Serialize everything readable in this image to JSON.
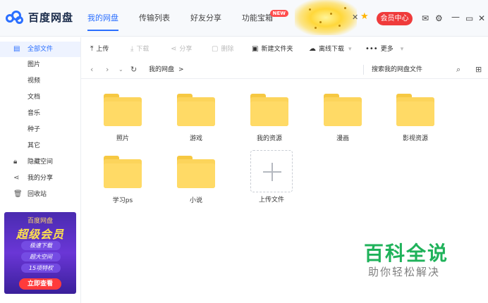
{
  "app": {
    "brand": "百度网盘"
  },
  "nav": {
    "items": [
      {
        "label": "我的网盘",
        "active": true
      },
      {
        "label": "传输列表",
        "active": false
      },
      {
        "label": "好友分享",
        "active": false
      },
      {
        "label": "功能宝箱",
        "active": false,
        "badge": "NEW"
      }
    ]
  },
  "header": {
    "close": "✕",
    "vip_label": "会员中心",
    "icons": [
      "mail-icon",
      "settings-icon",
      "minimize-icon",
      "maximize-icon",
      "close-icon"
    ]
  },
  "sidebar": {
    "items": [
      {
        "label": "全部文件",
        "icon": "file-icon",
        "active": true
      },
      {
        "label": "图片"
      },
      {
        "label": "视频"
      },
      {
        "label": "文档"
      },
      {
        "label": "音乐"
      },
      {
        "label": "种子"
      },
      {
        "label": "其它"
      },
      {
        "label": "隐藏空间",
        "icon": "lock-icon"
      },
      {
        "label": "我的分享",
        "icon": "share-icon"
      },
      {
        "label": "回收站",
        "icon": "trash-icon"
      }
    ]
  },
  "banner": {
    "brand": "百度网盘",
    "title": "超级会员",
    "lines": [
      "极速下载",
      "超大空间",
      "15项特权"
    ],
    "button": "立即查看"
  },
  "toolbar": {
    "upload": "上传",
    "download": "下载",
    "share": "分享",
    "delete": "删除",
    "new_folder": "新建文件夹",
    "offline_download": "离线下载",
    "more": "更多"
  },
  "address": {
    "crumb": "我的网盘",
    "sep": ">",
    "search_placeholder": "搜索我的网盘文件"
  },
  "files": [
    {
      "name": "照片"
    },
    {
      "name": "游戏"
    },
    {
      "name": "我的资源"
    },
    {
      "name": "漫画"
    },
    {
      "name": "影视资源"
    },
    {
      "name": "学习ps"
    },
    {
      "name": "小说"
    }
  ],
  "upload_tile": {
    "label": "上传文件"
  },
  "watermark": {
    "title": "百科全说",
    "subtitle": "助你轻松解决"
  },
  "colors": {
    "accent": "#2b6fff",
    "folder": "#fcd45b",
    "vip": "#ef3b3b",
    "watermark": "#1fb25a"
  }
}
